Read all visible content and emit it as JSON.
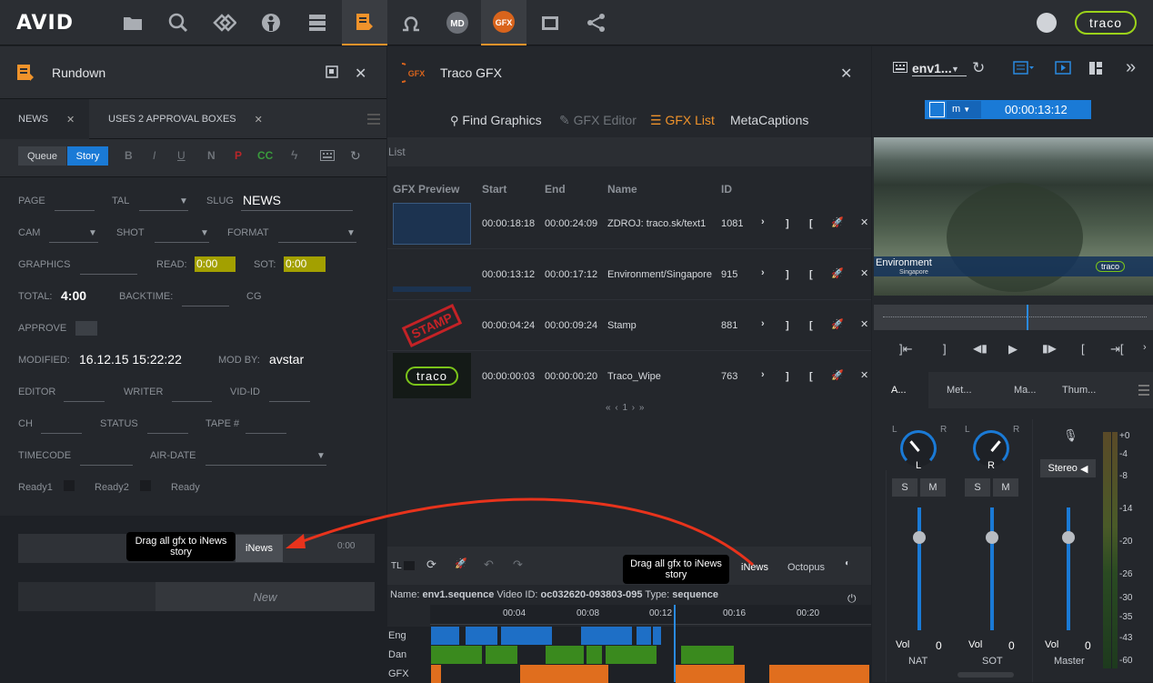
{
  "topbar": {
    "logo": "AVID",
    "traco_logo": "traco"
  },
  "rundown": {
    "title": "Rundown",
    "tabs": [
      "NEWS",
      "USES 2 APPROVAL BOXES"
    ],
    "mode_buttons": [
      "Queue",
      "Story"
    ],
    "format_icons": [
      "B",
      "I",
      "U",
      "N",
      "P",
      "CC"
    ],
    "fields": {
      "page": "PAGE",
      "tal": "TAL",
      "slug": "SLUG",
      "slug_value": "NEWS",
      "cam": "CAM",
      "shot": "SHOT",
      "format": "FORMAT",
      "graphics": "GRAPHICS",
      "read": "READ:",
      "read_value": "0:00",
      "sot": "SOT:",
      "sot_value": "0:00",
      "total": "TOTAL:",
      "total_value": "4:00",
      "backtime": "BACKTIME:",
      "cg": "CG",
      "approve": "APPROVE",
      "modified": "MODIFIED:",
      "modified_value": "16.12.15 15:22:22",
      "modby": "MOD BY:",
      "modby_value": "avstar",
      "editor": "EDITOR",
      "writer": "WRITER",
      "vidid": "VID-ID",
      "ch": "CH",
      "status": "STATUS",
      "tape": "TAPE #",
      "timecode": "TIMECODE",
      "airdate": "AIR-DATE",
      "ready1": "Ready1",
      "ready2": "Ready2",
      "ready": "Ready"
    },
    "drop_tooltip": "Drag all gfx to iNews story",
    "inews_label": "iNews",
    "drop_time": "0:00",
    "new_label": "New"
  },
  "traco": {
    "title": "Traco GFX",
    "nav": [
      "Find Graphics",
      "GFX Editor",
      "GFX List",
      "MetaCaptions"
    ],
    "list_label": "List",
    "columns": [
      "GFX Preview",
      "Start",
      "End",
      "Name",
      "ID"
    ],
    "rows": [
      {
        "start": "00:00:18:18",
        "end": "00:00:24:09",
        "name": "ZDROJ: traco.sk/text1",
        "id": "1081"
      },
      {
        "start": "00:00:13:12",
        "end": "00:00:17:12",
        "name": "Environment/Singapore",
        "id": "915"
      },
      {
        "start": "00:00:04:24",
        "end": "00:00:09:24",
        "name": "Stamp",
        "id": "881"
      },
      {
        "start": "00:00:00:03",
        "end": "00:00:00:20",
        "name": "Traco_Wipe",
        "id": "763"
      }
    ],
    "pagination": "« ‹ 1 › »",
    "thumb_stamp": "STAMP",
    "thumb_traco": "traco",
    "tl_label": "TL",
    "tooltip": "Drag all gfx to iNews story",
    "inews_tab": "iNews",
    "octopus_tab": "Octopus",
    "seq_info": {
      "name_label": "Name:",
      "name": "env1.sequence",
      "vid_label": "Video ID:",
      "vid": "oc032620-093803-095",
      "type_label": "Type:",
      "type": "sequence"
    },
    "ticks": [
      "00:04",
      "00:08",
      "00:12",
      "00:16",
      "00:20"
    ],
    "tracks": [
      "Eng",
      "Dan",
      "GFX"
    ]
  },
  "player": {
    "clip_name": "env1...",
    "mode": "m",
    "timecode": "00:00:13:12",
    "lower_third_title": "Environment",
    "lower_third_sub": "Singapore",
    "lower_third_logo": "traco",
    "tabs": [
      "A...",
      "Met...",
      "Ma...",
      "Thum..."
    ],
    "knob_l_side": "L",
    "knob_r_side": "R",
    "ch1_label": "L",
    "ch2_label": "R",
    "solo": "S",
    "mute": "M",
    "stereo": "Stereo",
    "vol_label": "Vol",
    "vol1": "0",
    "vol2": "0",
    "vol3": "0",
    "strips": [
      "NAT",
      "SOT",
      "Master"
    ],
    "db_scale": [
      "+0",
      "-4",
      "-8",
      "-14",
      "-20",
      "-26",
      "-30",
      "-35",
      "-43",
      "-60"
    ]
  }
}
